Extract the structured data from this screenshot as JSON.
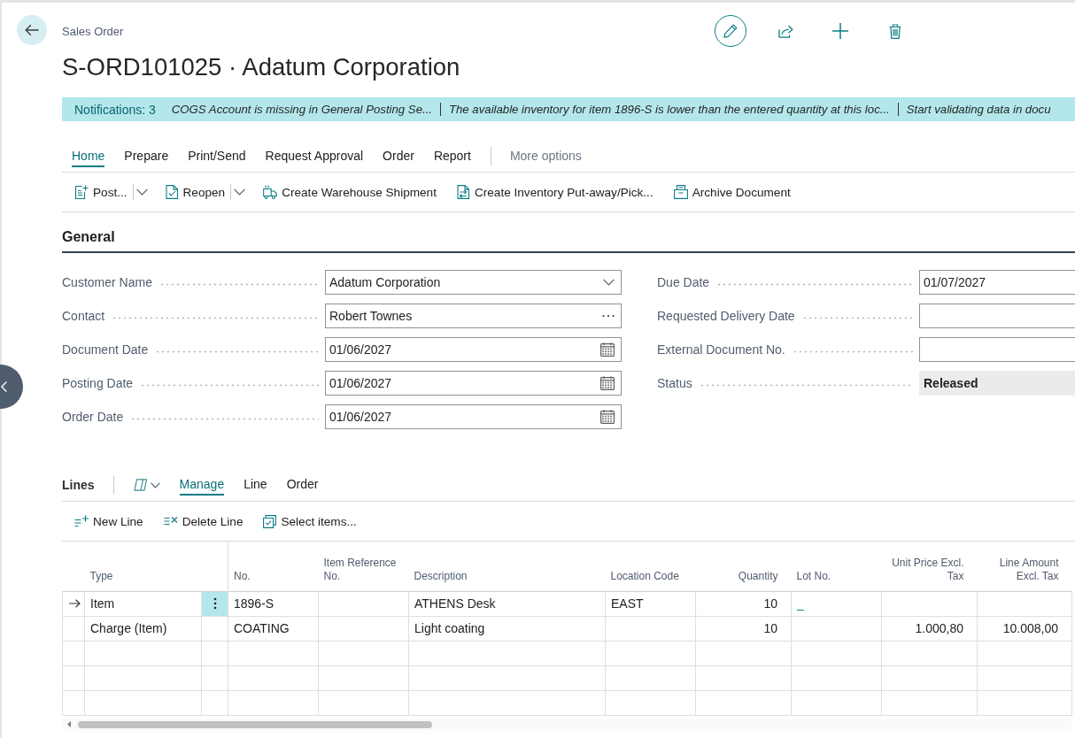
{
  "page": {
    "breadcrumb": "Sales Order",
    "title": "S-ORD101025 · Adatum Corporation"
  },
  "notifications": {
    "label": "Notifications: 3",
    "messages": [
      "COGS Account is missing in General Posting Se...",
      "The available inventory for item 1896-S is lower than the entered quantity at this loc...",
      "Start validating data in docu"
    ]
  },
  "action_tabs": [
    {
      "label": "Home",
      "selected": true
    },
    {
      "label": "Prepare",
      "selected": false
    },
    {
      "label": "Print/Send",
      "selected": false
    },
    {
      "label": "Request Approval",
      "selected": false
    },
    {
      "label": "Order",
      "selected": false
    },
    {
      "label": "Report",
      "selected": false
    }
  ],
  "more_options": "More options",
  "actions": [
    {
      "label": "Post...",
      "kind": "split"
    },
    {
      "label": "Reopen",
      "kind": "split"
    },
    {
      "label": "Create Warehouse Shipment",
      "kind": "plain"
    },
    {
      "label": "Create Inventory Put-away/Pick...",
      "kind": "plain"
    },
    {
      "label": "Archive Document",
      "kind": "plain"
    }
  ],
  "general": {
    "title": "General",
    "left_fields": [
      {
        "label": "Customer Name",
        "value": "Adatum Corporation",
        "kind": "dropdown"
      },
      {
        "label": "Contact",
        "value": "Robert Townes",
        "kind": "lookup"
      },
      {
        "label": "Document Date",
        "value": "01/06/2027",
        "kind": "date"
      },
      {
        "label": "Posting Date",
        "value": "01/06/2027",
        "kind": "date"
      },
      {
        "label": "Order Date",
        "value": "01/06/2027",
        "kind": "date"
      }
    ],
    "right_fields": [
      {
        "label": "Due Date",
        "value": "01/07/2027",
        "kind": "text"
      },
      {
        "label": "Requested Delivery Date",
        "kind": "text"
      },
      {
        "label": "External Document No.",
        "kind": "text"
      },
      {
        "label": "Status",
        "value": "Released",
        "kind": "readonly"
      }
    ]
  },
  "lines": {
    "title": "Lines",
    "tabs": [
      {
        "label": "Manage",
        "selected": true
      },
      {
        "label": "Line",
        "selected": false
      },
      {
        "label": "Order",
        "selected": false
      }
    ],
    "actions": [
      "New Line",
      "Delete Line",
      "Select items..."
    ],
    "table": {
      "columns": {
        "type": "Type",
        "no": "No.",
        "item_reference_no": "Item Reference No.",
        "description": "Description",
        "location_code": "Location Code",
        "quantity": "Quantity",
        "lot_no": "Lot No.",
        "unit_price_excl_tax": "Unit Price Excl. Tax",
        "line_amount_excl_tax": "Line Amount Excl. Tax"
      },
      "rows": [
        {
          "selected": true,
          "type": "Item",
          "no": "1896-S",
          "description": "ATHENS Desk",
          "location_code": "EAST",
          "quantity": "10",
          "lot_no": "_"
        },
        {
          "selected": false,
          "type": "Charge (Item)",
          "no": "COATING",
          "description": "Light coating",
          "quantity": "10",
          "unit_price_excl_tax": "1.000,80",
          "line_amount_excl_tax": "10.008,00"
        },
        {
          "selected": false
        },
        {
          "selected": false
        },
        {
          "selected": false
        }
      ]
    }
  }
}
